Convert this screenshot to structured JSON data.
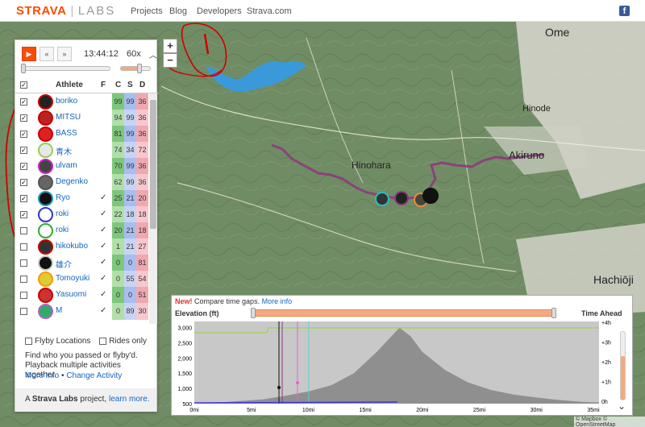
{
  "nav": {
    "brand": "STRAVA",
    "sep": "|",
    "labs": "LABS",
    "links": [
      "Projects",
      "Blog",
      "Developers",
      "Strava.com"
    ],
    "facebook": "f"
  },
  "map": {
    "places": [
      "Ome",
      "Hinode",
      "Hinohara",
      "Akiruno",
      "Hachiōji"
    ],
    "zoom_in": "+",
    "zoom_out": "−",
    "route_color": "#8e3a7e",
    "river_color": "#3a9ad9",
    "annotation_color": "#d00000"
  },
  "playback": {
    "play_icon": "▶",
    "rewind_icon": "«",
    "forward_icon": "»",
    "clock": "13:44:12",
    "speed": "60x",
    "speed_up_icon": "︿"
  },
  "table": {
    "header_athlete": "Athlete",
    "header_f": "F",
    "header_c": "C",
    "header_s": "S",
    "header_d": "D",
    "rows": [
      {
        "name": "boriko",
        "f": "",
        "c": "99",
        "s": "99",
        "d": "36",
        "checked": true,
        "ring": "#c00",
        "avatar_bg": "#222"
      },
      {
        "name": "MITSU",
        "f": "",
        "c": "94",
        "s": "99",
        "d": "36",
        "checked": true,
        "ring": "#c00",
        "avatar_bg": "#b22"
      },
      {
        "name": "BASS",
        "f": "",
        "c": "81",
        "s": "99",
        "d": "36",
        "checked": true,
        "ring": "#c00",
        "avatar_bg": "#d22"
      },
      {
        "name": "青木",
        "f": "",
        "c": "74",
        "s": "34",
        "d": "72",
        "checked": true,
        "ring": "#9c5",
        "avatar_bg": "#e8e8e8"
      },
      {
        "name": "ulvam",
        "f": "",
        "c": "70",
        "s": "99",
        "d": "36",
        "checked": true,
        "ring": "#c2c",
        "avatar_bg": "#444"
      },
      {
        "name": "Degenko",
        "f": "",
        "c": "62",
        "s": "99",
        "d": "36",
        "checked": true,
        "ring": "#555",
        "avatar_bg": "#666"
      },
      {
        "name": "Ryo",
        "f": "✓",
        "c": "25",
        "s": "21",
        "d": "20",
        "checked": true,
        "ring": "#29b",
        "avatar_bg": "#111"
      },
      {
        "name": "roki",
        "f": "✓",
        "c": "22",
        "s": "18",
        "d": "18",
        "checked": true,
        "ring": "#33c",
        "avatar_bg": "#fff"
      },
      {
        "name": "roki",
        "f": "✓",
        "c": "20",
        "s": "21",
        "d": "18",
        "checked": false,
        "ring": "#3a3",
        "avatar_bg": "#fff"
      },
      {
        "name": "hikokubo",
        "f": "✓",
        "c": "1",
        "s": "21",
        "d": "27",
        "checked": false,
        "ring": "#c00",
        "avatar_bg": "#333"
      },
      {
        "name": "雄介",
        "f": "✓",
        "c": "0",
        "s": "0",
        "d": "81",
        "checked": false,
        "ring": "#ccc",
        "avatar_bg": "#111"
      },
      {
        "name": "Tomoyuki",
        "f": "✓",
        "c": "0",
        "s": "55",
        "d": "54",
        "checked": false,
        "ring": "#f90",
        "avatar_bg": "#dc3"
      },
      {
        "name": "Yasuomi",
        "f": "✓",
        "c": "0",
        "s": "0",
        "d": "51",
        "checked": false,
        "ring": "#c00",
        "avatar_bg": "#c33"
      },
      {
        "name": "M",
        "f": "✓",
        "c": "0",
        "s": "89",
        "d": "30",
        "checked": false,
        "ring": "#a6c",
        "avatar_bg": "#3a6"
      }
    ]
  },
  "options": {
    "flyby_locations": "Flyby Locations",
    "rides_only": "Rides only"
  },
  "help": {
    "text": "Find who you passed or flyby'd. Playback multiple activities together.",
    "more_info": "More Info",
    "bullet": "•",
    "change_activity": "Change Activity"
  },
  "footer": {
    "prefix": "A",
    "brand": "Strava Labs",
    "middle": "project,",
    "link": "learn more."
  },
  "elevation": {
    "new_label": "New!",
    "compare_text": "Compare time gaps.",
    "more_info": "More info",
    "elevation_label": "Elevation (ft)",
    "time_label": "Time Ahead",
    "y_ticks": [
      "3,000",
      "2,500",
      "2,000",
      "1,500",
      "1,000",
      "500"
    ],
    "x_ticks": [
      "0mi",
      "5mi",
      "10mi",
      "15mi",
      "20mi",
      "25mi",
      "30mi",
      "35mi"
    ],
    "right_ticks": [
      "+4h",
      "+3h",
      "+2h",
      "+1h",
      "0h"
    ],
    "scroll_down_icon": "⌄",
    "chart_data": {
      "type": "area",
      "xlabel": "",
      "ylabel": "Elevation (ft)",
      "x": [
        0,
        3,
        6,
        8,
        10,
        12,
        14,
        16,
        17,
        18,
        19,
        20,
        22,
        24,
        26,
        28,
        30,
        32,
        34,
        35.5
      ],
      "values": [
        500,
        560,
        640,
        760,
        900,
        1100,
        1500,
        2200,
        2600,
        3000,
        2700,
        2200,
        1600,
        1200,
        950,
        800,
        700,
        620,
        560,
        540
      ],
      "xlim": [
        0,
        35.5
      ],
      "ylim": [
        500,
        3200
      ],
      "grid": true
    }
  },
  "attribution": "© Mapbox © OpenStreetMap"
}
